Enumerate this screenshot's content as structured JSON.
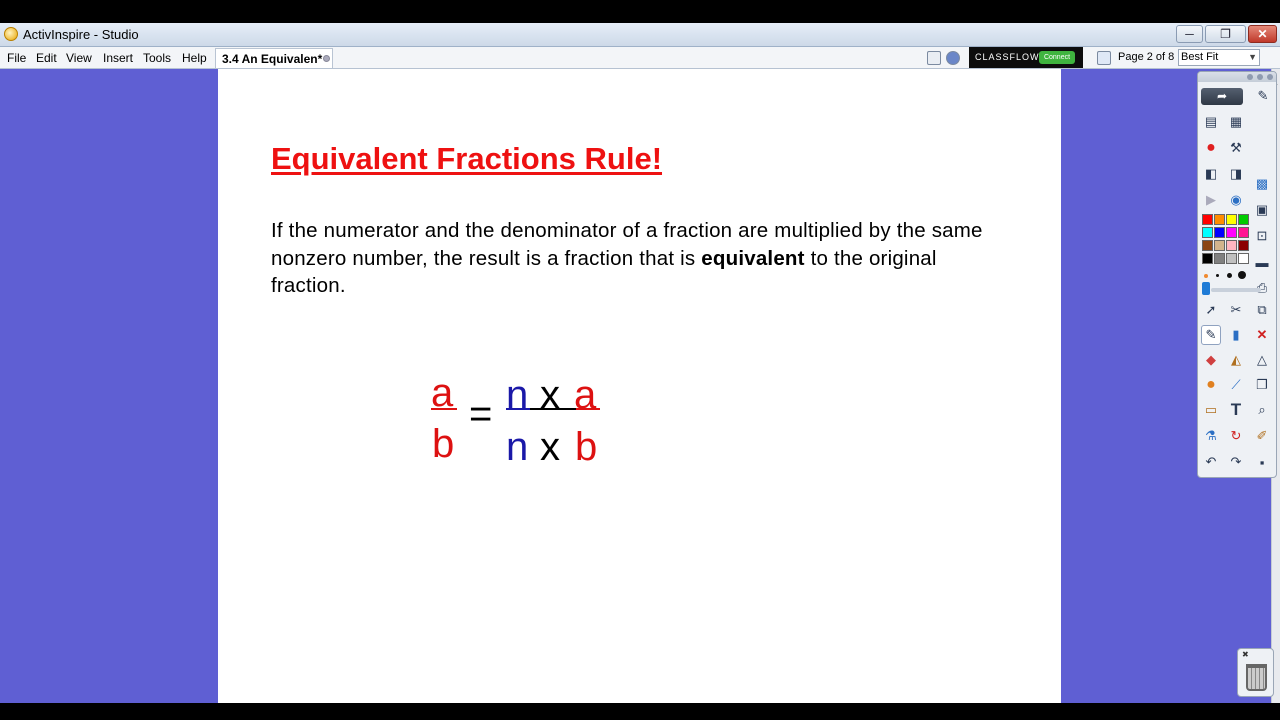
{
  "window": {
    "title": "ActivInspire - Studio",
    "min": "─",
    "restore": "❐",
    "close": "✕"
  },
  "menu": [
    "File",
    "Edit",
    "View",
    "Insert",
    "Tools",
    "Help"
  ],
  "doc_tab": {
    "label": "3.4 An Equivalen*"
  },
  "classflow": {
    "label": "CLASSFLOW",
    "connect": "Connect"
  },
  "page_indicator": "Page 2 of 8",
  "zoom": "Best Fit",
  "slide": {
    "title": "Equivalent Fractions Rule!",
    "rule_before": "If the numerator and the denominator of a fraction are multiplied by the same nonzero number, the result is a fraction that is ",
    "rule_bold": "equivalent",
    "rule_after": " to the original fraction.",
    "formula": {
      "left_num": "a",
      "left_den": "b",
      "equals": "=",
      "right_num_n": "n",
      "right_num_x": "x",
      "right_num_a": "a",
      "right_den_n": "n",
      "right_den_x": "x",
      "right_den_b": "b"
    }
  },
  "colors": {
    "workspace": "#5f5fd3",
    "title_red": "#ee1111",
    "letter_red": "#dd1111",
    "letter_blue": "#1a18a8"
  },
  "toolbox": {
    "palette": [
      "#ff0000",
      "#ff8c00",
      "#ffff00",
      "#00cc00",
      "#00ffff",
      "#0000ff",
      "#ff00ff",
      "#ff1493",
      "#8b4513",
      "#d2b48c",
      "#ffb6c1",
      "#8b0000",
      "#000000",
      "#808080",
      "#c0c0c0",
      "#ffffff"
    ],
    "icons": [
      "share-icon",
      "profile-icon",
      "page-browser-icon",
      "resource-browser-icon",
      "stop-icon",
      "tools-icon",
      "prev-page-icon",
      "next-page-icon",
      "grid-icon",
      "play-icon",
      "web-icon",
      "clipboard-icon",
      "cursor-icon",
      "multi-tool-icon",
      "pen-icon",
      "highlighter-icon",
      "delete-icon",
      "eraser-icon",
      "fill-icon",
      "shape-icon",
      "connector-icon",
      "text-icon",
      "undo-icon",
      "redo-icon",
      "save-icon"
    ]
  }
}
